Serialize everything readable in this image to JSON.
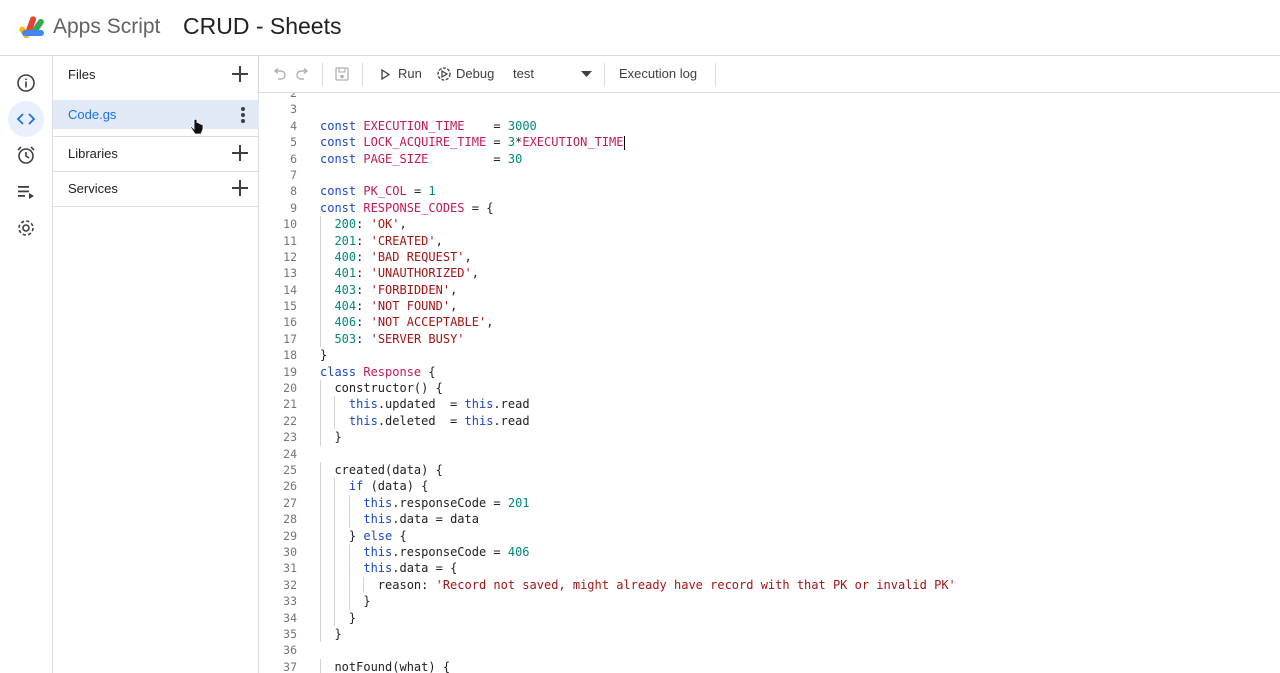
{
  "app": {
    "name": "Apps Script",
    "project_title": "CRUD - Sheets"
  },
  "rail": {
    "items": [
      {
        "icon": "info-icon"
      },
      {
        "icon": "code-icon",
        "active": true
      },
      {
        "icon": "alarm-clock-icon"
      },
      {
        "icon": "executions-icon"
      },
      {
        "icon": "gear-icon"
      }
    ]
  },
  "files_panel": {
    "files_label": "Files",
    "file": "Code.gs",
    "libraries_label": "Libraries",
    "services_label": "Services"
  },
  "toolbar": {
    "run_label": "Run",
    "debug_label": "Debug",
    "function_select": "test",
    "execution_log_label": "Execution log"
  },
  "editor": {
    "lines": [
      {
        "n": "2",
        "t": ""
      },
      {
        "n": "3",
        "t": ""
      },
      {
        "n": "4",
        "t": "const EXECUTION_TIME    = 3000"
      },
      {
        "n": "5",
        "t": "const LOCK_ACQUIRE_TIME = 3*EXECUTION_TIME"
      },
      {
        "n": "6",
        "t": "const PAGE_SIZE         = 30"
      },
      {
        "n": "7",
        "t": ""
      },
      {
        "n": "8",
        "t": "const PK_COL = 1"
      },
      {
        "n": "9",
        "t": "const RESPONSE_CODES = {"
      },
      {
        "n": "10",
        "t": "  200: 'OK',"
      },
      {
        "n": "11",
        "t": "  201: 'CREATED',"
      },
      {
        "n": "12",
        "t": "  400: 'BAD REQUEST',"
      },
      {
        "n": "13",
        "t": "  401: 'UNAUTHORIZED',"
      },
      {
        "n": "14",
        "t": "  403: 'FORBIDDEN',"
      },
      {
        "n": "15",
        "t": "  404: 'NOT FOUND',"
      },
      {
        "n": "16",
        "t": "  406: 'NOT ACCEPTABLE',"
      },
      {
        "n": "17",
        "t": "  503: 'SERVER BUSY'"
      },
      {
        "n": "18",
        "t": "}"
      },
      {
        "n": "19",
        "t": "class Response {"
      },
      {
        "n": "20",
        "t": "  constructor() {"
      },
      {
        "n": "21",
        "t": "    this.updated  = this.read"
      },
      {
        "n": "22",
        "t": "    this.deleted  = this.read"
      },
      {
        "n": "23",
        "t": "  }"
      },
      {
        "n": "24",
        "t": ""
      },
      {
        "n": "25",
        "t": "  created(data) {"
      },
      {
        "n": "26",
        "t": "    if (data) {"
      },
      {
        "n": "27",
        "t": "      this.responseCode = 201"
      },
      {
        "n": "28",
        "t": "      this.data = data"
      },
      {
        "n": "29",
        "t": "    } else {"
      },
      {
        "n": "30",
        "t": "      this.responseCode = 406"
      },
      {
        "n": "31",
        "t": "      this.data = {"
      },
      {
        "n": "32",
        "t": "        reason: 'Record not saved, might already have record with that PK or invalid PK'"
      },
      {
        "n": "33",
        "t": "      }"
      },
      {
        "n": "34",
        "t": "    }"
      },
      {
        "n": "35",
        "t": "  }"
      },
      {
        "n": "36",
        "t": ""
      },
      {
        "n": "37",
        "t": "  notFound(what) {"
      }
    ]
  }
}
